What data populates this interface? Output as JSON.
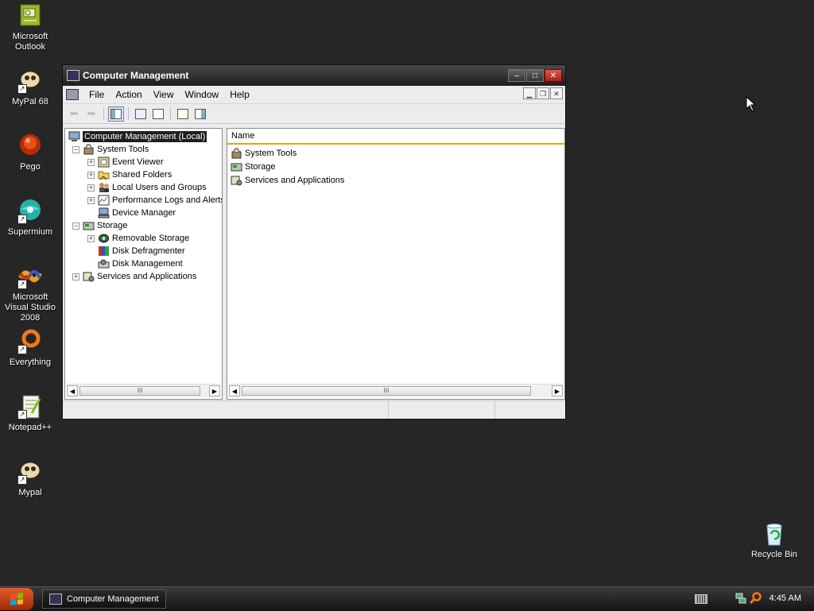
{
  "desktop": {
    "icons": [
      {
        "label": "Microsoft\nOutlook",
        "name": "microsoft-outlook"
      },
      {
        "label": "MyPal 68",
        "name": "mypal-68"
      },
      {
        "label": "Pego",
        "name": "pego"
      },
      {
        "label": "Supermium",
        "name": "supermium"
      },
      {
        "label": "Microsoft Visual Studio 2008",
        "name": "visual-studio-2008"
      },
      {
        "label": "Everything",
        "name": "everything"
      },
      {
        "label": "Notepad++",
        "name": "notepad-plus-plus"
      },
      {
        "label": "Mypal",
        "name": "mypal"
      }
    ],
    "recycle_bin": "Recycle Bin"
  },
  "window": {
    "title": "Computer Management",
    "caption_buttons": {
      "minimize": "–",
      "maximize": "□",
      "close": "✕"
    },
    "menu": [
      "File",
      "Action",
      "View",
      "Window",
      "Help"
    ],
    "tree": {
      "root": "Computer Management (Local)",
      "nodes": [
        {
          "label": "System Tools",
          "level": 1,
          "expander": "−",
          "icon": "tools-icon"
        },
        {
          "label": "Event Viewer",
          "level": 2,
          "expander": "+",
          "icon": "event-viewer-icon"
        },
        {
          "label": "Shared Folders",
          "level": 2,
          "expander": "+",
          "icon": "shared-folders-icon"
        },
        {
          "label": "Local Users and Groups",
          "level": 2,
          "expander": "+",
          "icon": "users-icon"
        },
        {
          "label": "Performance Logs and Alerts",
          "level": 2,
          "expander": "+",
          "icon": "performance-icon"
        },
        {
          "label": "Device Manager",
          "level": 2,
          "expander": "",
          "icon": "device-manager-icon"
        },
        {
          "label": "Storage",
          "level": 1,
          "expander": "−",
          "icon": "storage-icon"
        },
        {
          "label": "Removable Storage",
          "level": 2,
          "expander": "+",
          "icon": "removable-storage-icon"
        },
        {
          "label": "Disk Defragmenter",
          "level": 2,
          "expander": "",
          "icon": "defrag-icon"
        },
        {
          "label": "Disk Management",
          "level": 2,
          "expander": "",
          "icon": "disk-management-icon"
        },
        {
          "label": "Services and Applications",
          "level": 1,
          "expander": "+",
          "icon": "services-icon"
        }
      ]
    },
    "list": {
      "column": "Name",
      "items": [
        "System Tools",
        "Storage",
        "Services and Applications"
      ]
    },
    "scroll_grip": "III"
  },
  "taskbar": {
    "task_label": "Computer Management",
    "clock": "4:45 AM"
  },
  "colors": {
    "desktop": "#262626",
    "column_accent": "#e8a317",
    "selection": "#1e1e1e"
  }
}
